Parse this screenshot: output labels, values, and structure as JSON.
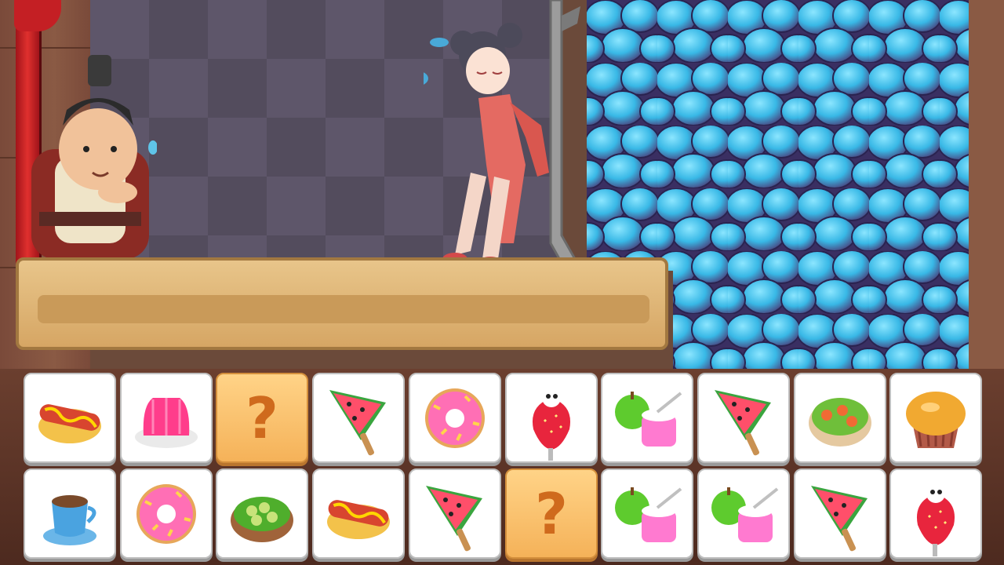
{
  "game": {
    "board": {
      "rows": [
        [
          "hotdog",
          "jelly",
          "mystery",
          "watermelon-popsicle",
          "donut",
          "strawberry-candy",
          "apple-yogurt",
          "watermelon-popsicle",
          "salad-bowl",
          "muffin"
        ],
        [
          "coffee",
          "donut",
          "olive-bowl",
          "hotdog",
          "watermelon-popsicle",
          "mystery",
          "apple-yogurt",
          "apple-yogurt",
          "watermelon-popsicle",
          "strawberry-candy"
        ]
      ],
      "mystery_symbol": "?"
    },
    "scene_items": [
      "merchant-character",
      "girl-character",
      "pull-pin",
      "blue-rock-pile",
      "wooden-platform",
      "red-curtain"
    ],
    "colors": {
      "mystery_tile": "#f5b259",
      "tile": "#ffffff",
      "rock": "#38b8e6"
    }
  }
}
